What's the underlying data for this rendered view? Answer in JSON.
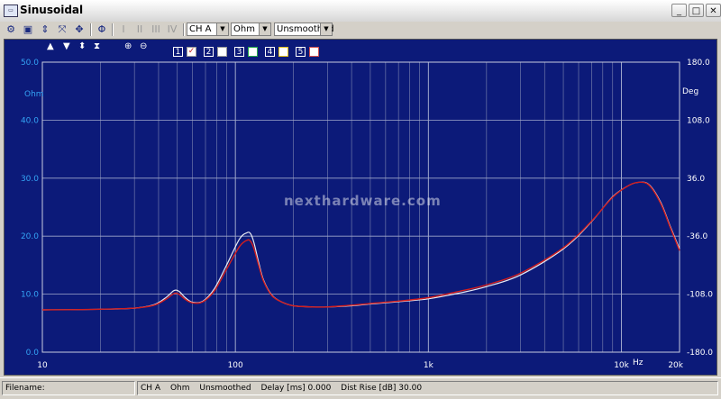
{
  "window": {
    "title": "Sinusoidal",
    "icon": "app-icon",
    "min": "_",
    "max": "□",
    "close": "✕"
  },
  "toolbar": {
    "channel": "CH A",
    "unit": "Ohm",
    "smoothing": "Unsmoothed"
  },
  "traces": [
    {
      "number": "1",
      "checked": true,
      "check_mark": "✓"
    },
    {
      "number": "2",
      "checked": false
    },
    {
      "number": "3",
      "checked": false
    },
    {
      "number": "4",
      "checked": false
    },
    {
      "number": "5",
      "checked": false
    }
  ],
  "plot": {
    "left_axis_unit": "Ohm",
    "right_axis_unit": "Deg",
    "x_unit": "Hz",
    "watermark": "nexthardware.com",
    "colors": {
      "background": "#0c1a79",
      "trace_white": "#ffffff",
      "trace_red": "#d21e1e",
      "axis_text": "#34a3f5"
    }
  },
  "chart_data": {
    "type": "line",
    "xscale": "log",
    "xlim": [
      10,
      20000
    ],
    "ylim": [
      0,
      50
    ],
    "y2lim": [
      -180,
      180
    ],
    "x_ticks": [
      "10",
      "100",
      "1k",
      "10k",
      "20k"
    ],
    "y_ticks": [
      "0.0",
      "10.0",
      "20.0",
      "30.0",
      "40.0",
      "50.0"
    ],
    "y2_ticks": [
      "-180.0",
      "-108.0",
      "-36.0",
      "36.0",
      "108.0",
      "180.0"
    ],
    "series": [
      {
        "color": "#ffffff",
        "x": [
          10,
          20,
          30,
          38,
          44,
          48,
          51,
          55,
          60,
          68,
          78,
          90,
          105,
          115,
          120,
          125,
          132,
          140,
          155,
          175,
          200,
          250,
          300,
          400,
          500,
          700,
          1000,
          1500,
          2000,
          3000,
          5000,
          7000,
          9000,
          11000,
          12500,
          14000,
          16000,
          18000,
          20000
        ],
        "y": [
          7.3,
          7.4,
          7.6,
          8.2,
          9.5,
          10.6,
          10.5,
          9.4,
          8.6,
          8.8,
          11.0,
          15.0,
          19.5,
          20.6,
          20.4,
          18.8,
          15.5,
          12.4,
          9.8,
          8.6,
          8.0,
          7.8,
          7.8,
          8.0,
          8.3,
          8.7,
          9.2,
          10.3,
          11.3,
          13.3,
          17.8,
          22.5,
          26.8,
          28.8,
          29.3,
          28.8,
          25.8,
          21.5,
          17.8
        ]
      },
      {
        "color": "#d21e1e",
        "x": [
          10,
          20,
          30,
          38,
          44,
          48,
          51,
          55,
          60,
          68,
          78,
          90,
          105,
          115,
          120,
          125,
          132,
          140,
          155,
          175,
          200,
          250,
          300,
          400,
          500,
          700,
          1000,
          1500,
          2000,
          3000,
          5000,
          7000,
          9000,
          11000,
          12500,
          14000,
          16000,
          18000,
          20000
        ],
        "y": [
          7.3,
          7.4,
          7.6,
          8.1,
          9.2,
          10.1,
          10.0,
          9.1,
          8.5,
          8.7,
          10.6,
          14.3,
          18.2,
          19.3,
          19.1,
          17.8,
          15.0,
          12.2,
          9.7,
          8.6,
          8.0,
          7.8,
          7.8,
          8.1,
          8.4,
          8.8,
          9.4,
          10.6,
          11.6,
          13.6,
          18.0,
          22.6,
          26.7,
          28.8,
          29.3,
          28.7,
          25.6,
          21.3,
          17.5
        ]
      }
    ]
  },
  "status": {
    "filename_label": "Filename:",
    "channel": "CH A",
    "unit": "Ohm",
    "smoothing": "Unsmoothed",
    "delay": "Delay [ms] 0.000",
    "dist_rise": "Dist Rise [dB] 30.00"
  }
}
